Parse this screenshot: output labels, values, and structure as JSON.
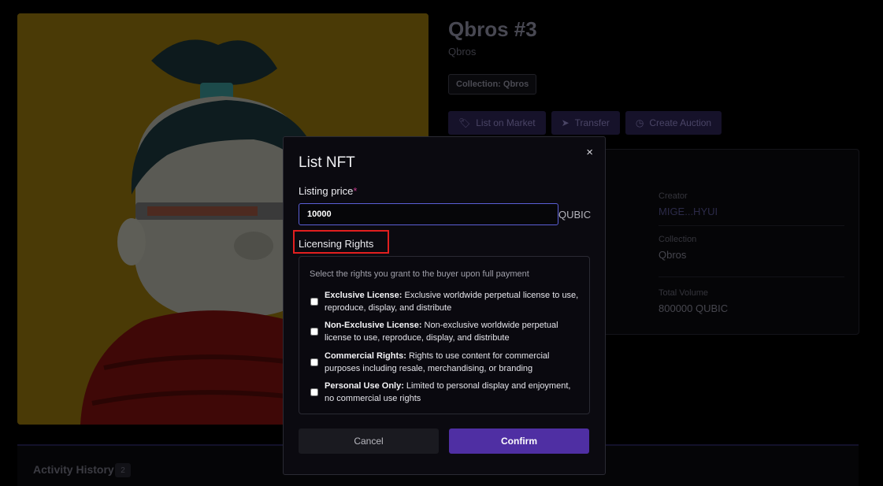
{
  "nft": {
    "title": "Qbros #3",
    "subtitle": "Qbros",
    "collection_badge": "Collection: Qbros",
    "image_alt_icon": "nft-artwork"
  },
  "actions": [
    {
      "label": "List on Market",
      "icon": "tag-icon"
    },
    {
      "label": "Transfer",
      "icon": "send-icon"
    },
    {
      "label": "Create Auction",
      "icon": "clock-icon"
    }
  ],
  "info": {
    "creator_label": "Creator",
    "creator_value": "MIGE...HYUI",
    "collection_label": "Collection",
    "collection_value": "Qbros",
    "volume_label": "Total Volume",
    "volume_value": "800000 QUBIC"
  },
  "activity": {
    "title": "Activity History",
    "count": "2"
  },
  "modal": {
    "title": "List NFT",
    "close_glyph": "×",
    "price_label": "Listing price",
    "price_required": "*",
    "price_value": "10000",
    "price_unit": "QUBIC",
    "rights_label": "Licensing Rights",
    "rights_hint": "Select the rights you grant to the buyer upon full payment",
    "rights": [
      {
        "name": "Exclusive License:",
        "desc": " Exclusive worldwide perpetual license to use, reproduce, display, and distribute",
        "checked": false
      },
      {
        "name": "Non-Exclusive License:",
        "desc": " Non-exclusive worldwide perpetual license to use, reproduce, display, and distribute",
        "checked": false
      },
      {
        "name": "Commercial Rights:",
        "desc": " Rights to use content for commercial purposes including resale, merchandising, or branding",
        "checked": false
      },
      {
        "name": "Personal Use Only:",
        "desc": " Limited to personal display and enjoyment, no commercial use rights",
        "checked": false
      }
    ],
    "cancel_label": "Cancel",
    "confirm_label": "Confirm"
  },
  "colors": {
    "accent": "#4f2fa3",
    "input_focus": "#5b5fd6",
    "highlight": "#e21f1f",
    "required": "#c23a8a"
  }
}
